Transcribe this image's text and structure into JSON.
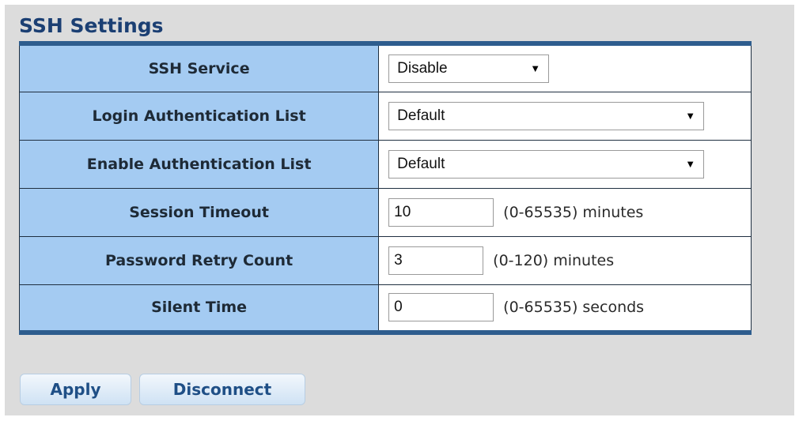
{
  "page": {
    "title": "SSH Settings"
  },
  "settings": {
    "ssh_service": {
      "label": "SSH Service",
      "value": "Disable"
    },
    "login_auth_list": {
      "label": "Login Authentication List",
      "value": "Default"
    },
    "enable_auth_list": {
      "label": "Enable Authentication List",
      "value": "Default"
    },
    "session_timeout": {
      "label": "Session Timeout",
      "value": "10",
      "hint": "(0-65535) minutes"
    },
    "password_retry": {
      "label": "Password Retry Count",
      "value": "3",
      "hint": "(0-120) minutes"
    },
    "silent_time": {
      "label": "Silent Time",
      "value": "0",
      "hint": "(0-65535) seconds"
    }
  },
  "buttons": {
    "apply": "Apply",
    "disconnect": "Disconnect"
  },
  "icons": {
    "dropdown": "chevron-down-icon"
  },
  "colors": {
    "background": "#dcdcdc",
    "title": "#1b3f73",
    "label_cell": "#a4cbf2",
    "table_border": "#2e5d8e",
    "button_text": "#1f4f86"
  }
}
